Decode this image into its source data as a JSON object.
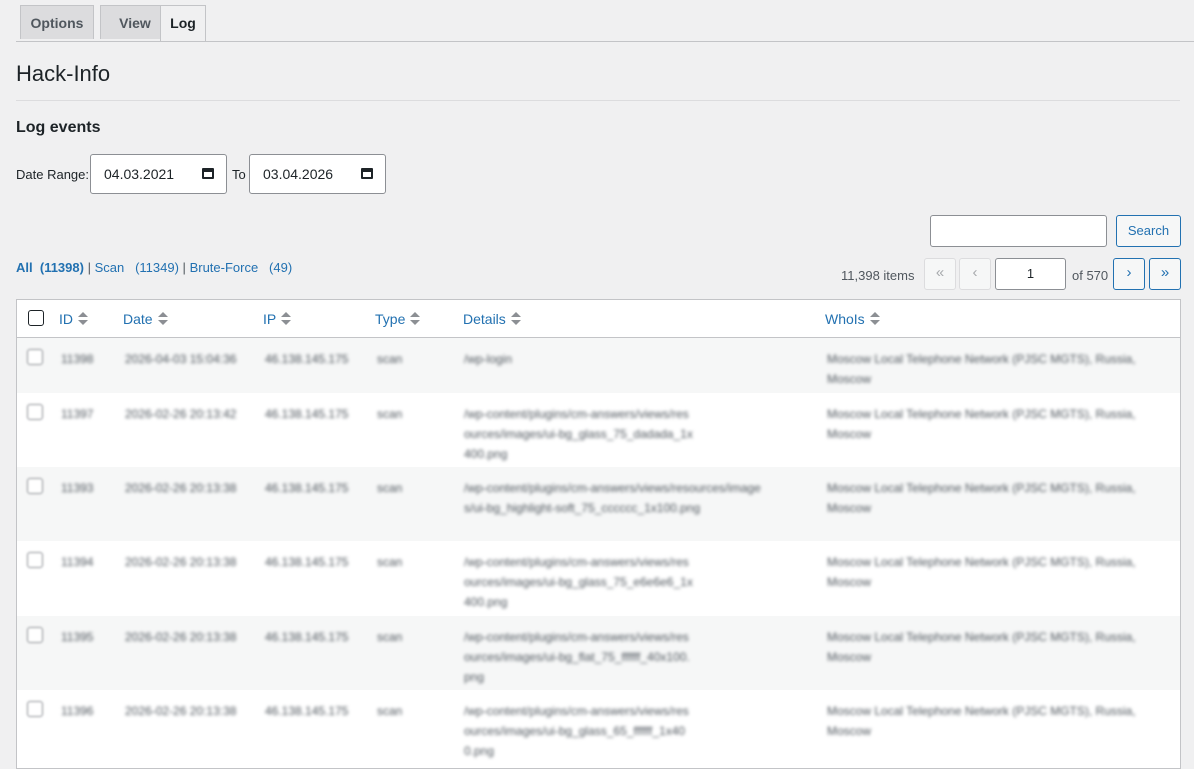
{
  "tabs": [
    {
      "label": "Options"
    },
    {
      "label": "View"
    },
    {
      "label": "Log"
    }
  ],
  "page_title": "Hack-Info",
  "section_title": "Log events",
  "date_range": {
    "label": "Date Range:",
    "from": "04.03.2021",
    "to_label": "To",
    "to": "03.04.2026"
  },
  "search": {
    "button": "Search",
    "value": ""
  },
  "filters": {
    "all_label": "All",
    "all_count": "(11398)",
    "scan_label": "Scan",
    "scan_count": "(11349)",
    "brute_label": "Brute-Force",
    "brute_count": "(49)",
    "separator": "|"
  },
  "pagination": {
    "items": "11,398 items",
    "first": "«",
    "prev": "‹",
    "current_page": "1",
    "of": "of 570",
    "next": "›",
    "last": "»"
  },
  "table": {
    "columns": [
      "ID",
      "Date",
      "IP",
      "Type",
      "Details",
      "WhoIs"
    ],
    "rows": [
      {
        "id": "11398",
        "date": "2026-04-03 15:04:36",
        "ip": "46.138.145.175",
        "type": "scan",
        "details": "/wp-login",
        "whois": "Moscow Local Telephone Network (PJSC MGTS), Russia, Moscow"
      },
      {
        "id": "11397",
        "date": "2026-02-26 20:13:42",
        "ip": "46.138.145.175",
        "type": "scan",
        "details": "/wp-content/plugins/cm-answers/views/resources/images/ui-bg_glass_75_dadada_1x400.png",
        "whois": "Moscow Local Telephone Network (PJSC MGTS), Russia, Moscow"
      },
      {
        "id": "11393",
        "date": "2026-02-26 20:13:38",
        "ip": "46.138.145.175",
        "type": "scan",
        "details": "/wp-content/plugins/cm-answers/views/resources/images/ui-bg_highlight-soft_75_cccccc_1x100.png",
        "whois": "Moscow Local Telephone Network (PJSC MGTS), Russia, Moscow"
      },
      {
        "id": "11394",
        "date": "2026-02-26 20:13:38",
        "ip": "46.138.145.175",
        "type": "scan",
        "details": "/wp-content/plugins/cm-answers/views/resources/images/ui-bg_glass_75_e6e6e6_1x400.png",
        "whois": "Moscow Local Telephone Network (PJSC MGTS), Russia, Moscow"
      },
      {
        "id": "11395",
        "date": "2026-02-26 20:13:38",
        "ip": "46.138.145.175",
        "type": "scan",
        "details": "/wp-content/plugins/cm-answers/views/resources/images/ui-bg_flat_75_ffffff_40x100.png",
        "whois": "Moscow Local Telephone Network (PJSC MGTS), Russia, Moscow"
      },
      {
        "id": "11396",
        "date": "2026-02-26 20:13:38",
        "ip": "46.138.145.175",
        "type": "scan",
        "details": "/wp-content/plugins/cm-answers/views/resources/images/ui-bg_glass_65_ffffff_1x400.png",
        "whois": "Moscow Local Telephone Network (PJSC MGTS), Russia, Moscow"
      }
    ]
  },
  "colors": {
    "link": "#2271b1",
    "text": "#1d2327",
    "background": "#f0f0f1"
  }
}
